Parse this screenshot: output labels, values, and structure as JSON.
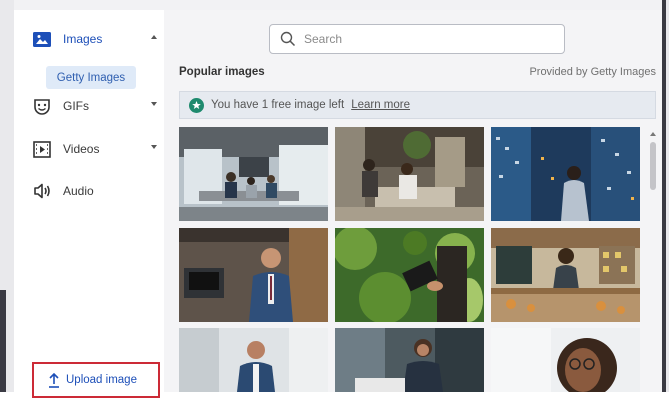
{
  "sidebar": {
    "items": [
      {
        "label": "Images",
        "icon": "image-icon",
        "expanded": true
      },
      {
        "label": "GIFs",
        "icon": "gif-icon",
        "expanded": false
      },
      {
        "label": "Videos",
        "icon": "video-icon",
        "expanded": false
      },
      {
        "label": "Audio",
        "icon": "audio-icon"
      }
    ],
    "subitem": "Getty Images",
    "upload_label": "Upload image"
  },
  "search": {
    "placeholder": "Search",
    "value": ""
  },
  "main": {
    "section_title": "Popular images",
    "provider": "Provided by Getty Images",
    "banner_text": "You have 1 free image left",
    "banner_link": "Learn more"
  },
  "images": [
    {
      "subject": "office-meeting"
    },
    {
      "subject": "lobby-conversation"
    },
    {
      "subject": "city-at-night"
    },
    {
      "subject": "businessman-portrait"
    },
    {
      "subject": "plants-tablet"
    },
    {
      "subject": "kitchen-cooking"
    },
    {
      "subject": "man-standing"
    },
    {
      "subject": "woman-laptop"
    },
    {
      "subject": "woman-glasses"
    }
  ],
  "colors": {
    "accent": "#1d4fb8",
    "highlight": "#cc2a36",
    "badge": "#1e8a6e"
  }
}
